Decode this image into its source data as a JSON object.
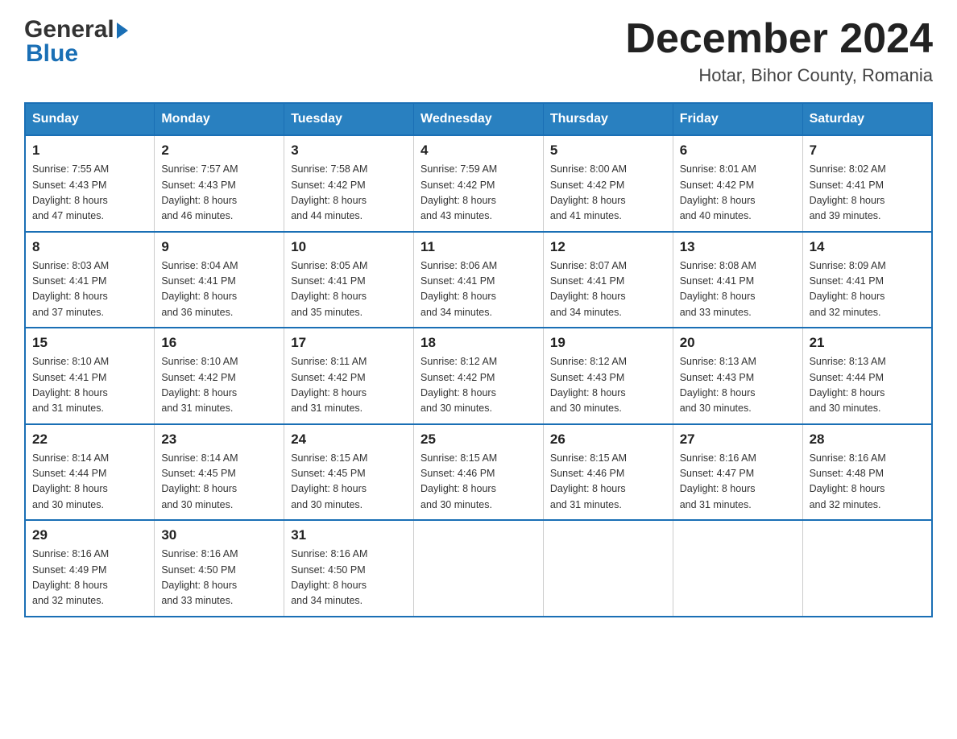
{
  "header": {
    "logo_general": "General",
    "logo_blue": "Blue",
    "month_title": "December 2024",
    "location": "Hotar, Bihor County, Romania"
  },
  "weekdays": [
    "Sunday",
    "Monday",
    "Tuesday",
    "Wednesday",
    "Thursday",
    "Friday",
    "Saturday"
  ],
  "weeks": [
    [
      {
        "day": "1",
        "sunrise": "7:55 AM",
        "sunset": "4:43 PM",
        "daylight": "8 hours and 47 minutes."
      },
      {
        "day": "2",
        "sunrise": "7:57 AM",
        "sunset": "4:43 PM",
        "daylight": "8 hours and 46 minutes."
      },
      {
        "day": "3",
        "sunrise": "7:58 AM",
        "sunset": "4:42 PM",
        "daylight": "8 hours and 44 minutes."
      },
      {
        "day": "4",
        "sunrise": "7:59 AM",
        "sunset": "4:42 PM",
        "daylight": "8 hours and 43 minutes."
      },
      {
        "day": "5",
        "sunrise": "8:00 AM",
        "sunset": "4:42 PM",
        "daylight": "8 hours and 41 minutes."
      },
      {
        "day": "6",
        "sunrise": "8:01 AM",
        "sunset": "4:42 PM",
        "daylight": "8 hours and 40 minutes."
      },
      {
        "day": "7",
        "sunrise": "8:02 AM",
        "sunset": "4:41 PM",
        "daylight": "8 hours and 39 minutes."
      }
    ],
    [
      {
        "day": "8",
        "sunrise": "8:03 AM",
        "sunset": "4:41 PM",
        "daylight": "8 hours and 37 minutes."
      },
      {
        "day": "9",
        "sunrise": "8:04 AM",
        "sunset": "4:41 PM",
        "daylight": "8 hours and 36 minutes."
      },
      {
        "day": "10",
        "sunrise": "8:05 AM",
        "sunset": "4:41 PM",
        "daylight": "8 hours and 35 minutes."
      },
      {
        "day": "11",
        "sunrise": "8:06 AM",
        "sunset": "4:41 PM",
        "daylight": "8 hours and 34 minutes."
      },
      {
        "day": "12",
        "sunrise": "8:07 AM",
        "sunset": "4:41 PM",
        "daylight": "8 hours and 34 minutes."
      },
      {
        "day": "13",
        "sunrise": "8:08 AM",
        "sunset": "4:41 PM",
        "daylight": "8 hours and 33 minutes."
      },
      {
        "day": "14",
        "sunrise": "8:09 AM",
        "sunset": "4:41 PM",
        "daylight": "8 hours and 32 minutes."
      }
    ],
    [
      {
        "day": "15",
        "sunrise": "8:10 AM",
        "sunset": "4:41 PM",
        "daylight": "8 hours and 31 minutes."
      },
      {
        "day": "16",
        "sunrise": "8:10 AM",
        "sunset": "4:42 PM",
        "daylight": "8 hours and 31 minutes."
      },
      {
        "day": "17",
        "sunrise": "8:11 AM",
        "sunset": "4:42 PM",
        "daylight": "8 hours and 31 minutes."
      },
      {
        "day": "18",
        "sunrise": "8:12 AM",
        "sunset": "4:42 PM",
        "daylight": "8 hours and 30 minutes."
      },
      {
        "day": "19",
        "sunrise": "8:12 AM",
        "sunset": "4:43 PM",
        "daylight": "8 hours and 30 minutes."
      },
      {
        "day": "20",
        "sunrise": "8:13 AM",
        "sunset": "4:43 PM",
        "daylight": "8 hours and 30 minutes."
      },
      {
        "day": "21",
        "sunrise": "8:13 AM",
        "sunset": "4:44 PM",
        "daylight": "8 hours and 30 minutes."
      }
    ],
    [
      {
        "day": "22",
        "sunrise": "8:14 AM",
        "sunset": "4:44 PM",
        "daylight": "8 hours and 30 minutes."
      },
      {
        "day": "23",
        "sunrise": "8:14 AM",
        "sunset": "4:45 PM",
        "daylight": "8 hours and 30 minutes."
      },
      {
        "day": "24",
        "sunrise": "8:15 AM",
        "sunset": "4:45 PM",
        "daylight": "8 hours and 30 minutes."
      },
      {
        "day": "25",
        "sunrise": "8:15 AM",
        "sunset": "4:46 PM",
        "daylight": "8 hours and 30 minutes."
      },
      {
        "day": "26",
        "sunrise": "8:15 AM",
        "sunset": "4:46 PM",
        "daylight": "8 hours and 31 minutes."
      },
      {
        "day": "27",
        "sunrise": "8:16 AM",
        "sunset": "4:47 PM",
        "daylight": "8 hours and 31 minutes."
      },
      {
        "day": "28",
        "sunrise": "8:16 AM",
        "sunset": "4:48 PM",
        "daylight": "8 hours and 32 minutes."
      }
    ],
    [
      {
        "day": "29",
        "sunrise": "8:16 AM",
        "sunset": "4:49 PM",
        "daylight": "8 hours and 32 minutes."
      },
      {
        "day": "30",
        "sunrise": "8:16 AM",
        "sunset": "4:50 PM",
        "daylight": "8 hours and 33 minutes."
      },
      {
        "day": "31",
        "sunrise": "8:16 AM",
        "sunset": "4:50 PM",
        "daylight": "8 hours and 34 minutes."
      },
      null,
      null,
      null,
      null
    ]
  ],
  "labels": {
    "sunrise": "Sunrise:",
    "sunset": "Sunset:",
    "daylight": "Daylight:"
  }
}
